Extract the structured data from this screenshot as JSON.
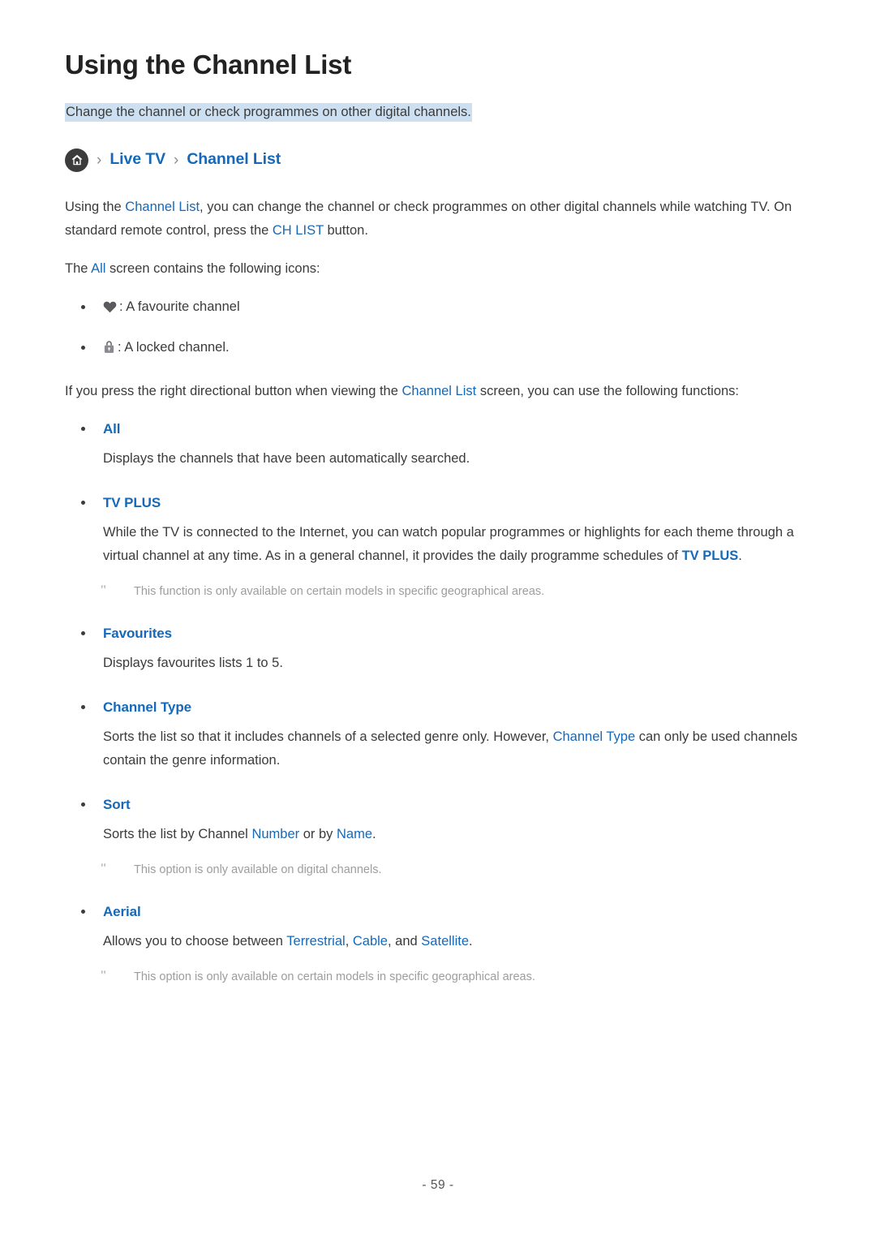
{
  "document": {
    "title": "Using the Channel List",
    "subtitle": "Change the channel or check programmes on other digital channels.",
    "page_number": "- 59 -"
  },
  "colors": {
    "link_blue": "#1668b8",
    "highlight": "#cce0f2",
    "text": "#3b3b3b",
    "note_gray": "#9d9d9d"
  },
  "breadcrumb": {
    "home_icon": "home-icon",
    "separator": "›",
    "items": [
      {
        "label": "Live TV"
      },
      {
        "label": "Channel List"
      }
    ]
  },
  "intro": {
    "p1_a": "Using the ",
    "p1_link1": "Channel List",
    "p1_b": ", you can change the channel or check programmes on other digital channels while watching TV. On standard remote control, press the ",
    "p1_link2": "CH LIST",
    "p1_c": " button.",
    "p2_a": "The ",
    "p2_link": "All",
    "p2_b": " screen contains the following icons:"
  },
  "icon_list": [
    {
      "icon": "heart-icon",
      "text": ": A favourite channel"
    },
    {
      "icon": "lock-icon",
      "text": ": A locked channel."
    }
  ],
  "functions_intro": {
    "a": "If you press the right directional button when viewing the ",
    "link": "Channel List",
    "b": " screen, you can use the following functions:"
  },
  "functions": [
    {
      "heading": "All",
      "body_a": "Displays the channels that have been automatically searched.",
      "body_link": "",
      "body_b": "",
      "notes": []
    },
    {
      "heading": "TV PLUS",
      "body_a": "While the TV is connected to the Internet, you can watch popular programmes or highlights for each theme through a virtual channel at any time. As in a general channel, it provides the daily programme schedules of ",
      "body_link": "TV PLUS",
      "body_b": ".",
      "notes": [
        {
          "mark": "\"",
          "text": "This function is only available on certain models in specific geographical areas."
        }
      ]
    },
    {
      "heading": "Favourites",
      "body_a": "Displays favourites lists 1 to 5.",
      "body_link": "",
      "body_b": "",
      "notes": []
    },
    {
      "heading": "Channel Type",
      "body_a": "Sorts the list so that it includes channels of a selected genre only. However, ",
      "body_link": "Channel Type",
      "body_b": " can only be used channels contain the genre information.",
      "notes": []
    },
    {
      "heading": "Sort",
      "body_a": "Sorts the list by Channel ",
      "body_link": "Number",
      "body_b": " or by ",
      "body_link2": "Name",
      "body_c": ".",
      "notes": [
        {
          "mark": "\"",
          "text": "This option is only available on digital channels."
        }
      ]
    },
    {
      "heading": "Aerial",
      "body_a": "Allows you to choose between ",
      "body_link": "Terrestrial",
      "body_b": ", ",
      "body_link2": "Cable",
      "body_c": ", and ",
      "body_link3": "Satellite",
      "body_d": ".",
      "notes": [
        {
          "mark": "\"",
          "text": "This option is only available on certain models in specific geographical areas."
        }
      ]
    }
  ]
}
